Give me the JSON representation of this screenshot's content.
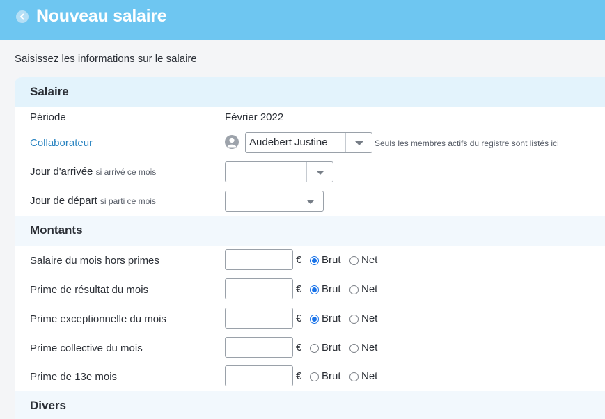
{
  "header": {
    "title": "Nouveau salaire"
  },
  "subtitle": "Saisissez les informations sur le salaire",
  "sections": {
    "salaire": "Salaire",
    "montants": "Montants",
    "divers": "Divers"
  },
  "periode": {
    "label": "Période",
    "value": "Février 2022"
  },
  "collaborateur": {
    "label": "Collaborateur",
    "selected": "Audebert Justine",
    "hint": "Seuls les membres actifs du registre sont listés ici"
  },
  "arrivee": {
    "label": "Jour d'arrivée",
    "hint": "si arrivé ce mois",
    "selected": ""
  },
  "depart": {
    "label": "Jour de départ",
    "hint": "si parti ce mois",
    "selected": ""
  },
  "currency": "€",
  "radio_labels": {
    "brut": "Brut",
    "net": "Net"
  },
  "amounts": [
    {
      "label": "Salaire du mois hors primes",
      "value": "",
      "mode": "Brut"
    },
    {
      "label": "Prime de résultat du mois",
      "value": "",
      "mode": "Brut"
    },
    {
      "label": "Prime exceptionnelle du mois",
      "value": "",
      "mode": "Brut"
    },
    {
      "label": "Prime collective du mois",
      "value": "",
      "mode": ""
    },
    {
      "label": "Prime de 13e mois",
      "value": "",
      "mode": ""
    }
  ],
  "colors": {
    "header": "#6ec6f1",
    "link": "#2a84c1",
    "radio": "#1a73e8"
  }
}
